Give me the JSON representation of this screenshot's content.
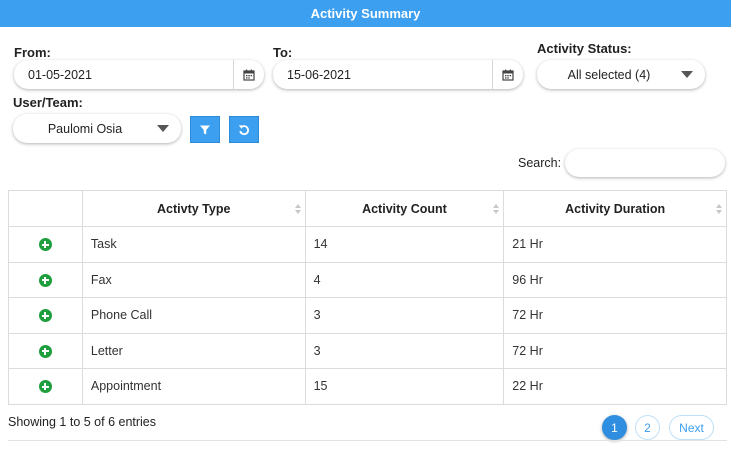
{
  "header": {
    "title": "Activity Summary"
  },
  "filters": {
    "from_label": "From:",
    "from_value": "01-05-2021",
    "to_label": "To:",
    "to_value": "15-06-2021",
    "status_label": "Activity Status:",
    "status_value": "All selected (4)",
    "user_label": "User/Team:",
    "user_value": "Paulomi Osia"
  },
  "search": {
    "label": "Search:",
    "value": ""
  },
  "table": {
    "headers": [
      "Activty Type",
      "Activity Count",
      "Activity Duration"
    ],
    "rows": [
      {
        "type": "Task",
        "count": "14",
        "duration": "21 Hr"
      },
      {
        "type": "Fax",
        "count": "4",
        "duration": "96 Hr"
      },
      {
        "type": "Phone Call",
        "count": "3",
        "duration": "72 Hr"
      },
      {
        "type": "Letter",
        "count": "3",
        "duration": "72 Hr"
      },
      {
        "type": "Appointment",
        "count": "15",
        "duration": "22 Hr"
      }
    ]
  },
  "footer": {
    "info": "Showing 1 to 5 of 6 entries",
    "pages": [
      "1",
      "2"
    ],
    "next_label": "Next"
  },
  "icons": {
    "calendar": "calendar-icon",
    "filter": "filter-icon",
    "reset": "reset-icon",
    "expand": "plus-circle-icon",
    "dropdown": "chevron-down-icon"
  },
  "colors": {
    "accent": "#3d9ff0",
    "expand": "#1e9e3c"
  }
}
